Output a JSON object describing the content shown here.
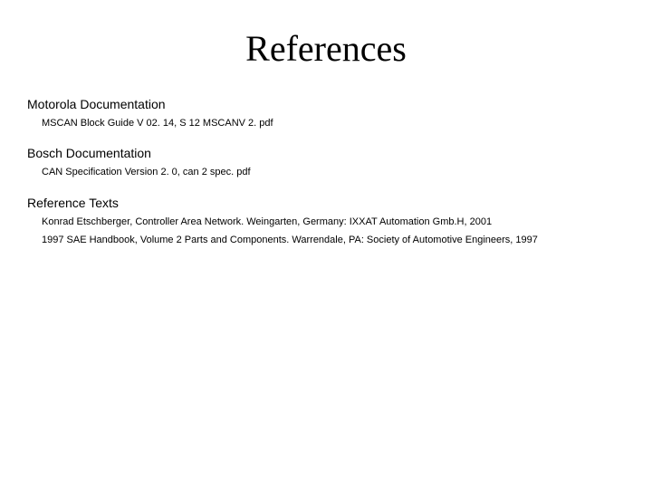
{
  "title": "References",
  "sections": [
    {
      "heading": "Motorola Documentation",
      "items": [
        "MSCAN Block Guide V 02. 14, S 12 MSCANV 2. pdf"
      ]
    },
    {
      "heading": "Bosch Documentation",
      "items": [
        "CAN Specification Version 2. 0, can 2 spec. pdf"
      ]
    },
    {
      "heading": "Reference Texts",
      "items": [
        "Konrad Etschberger, Controller Area Network. Weingarten, Germany: IXXAT Automation Gmb.H, 2001",
        "1997 SAE Handbook, Volume 2 Parts and Components. Warrendale, PA: Society of Automotive Engineers, 1997"
      ]
    }
  ]
}
